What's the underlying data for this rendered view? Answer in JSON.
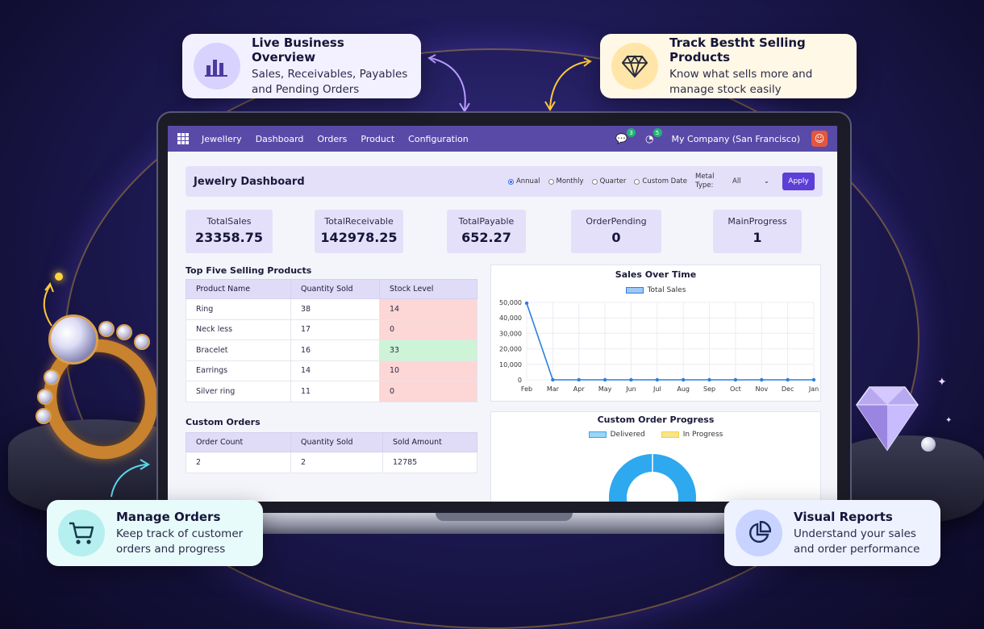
{
  "callouts": {
    "top_left": {
      "title": "Live Business Overview",
      "text": "Sales, Receivables, Payables and Pending Orders",
      "icon": "bar-chart-icon"
    },
    "top_right": {
      "title": "Track Bestht Selling Products",
      "text": "Know what sells more and manage stock easily",
      "icon": "diamond-icon"
    },
    "bottom_left": {
      "title": "Manage Orders",
      "text": "Keep track of customer orders and progress",
      "icon": "cart-icon"
    },
    "bottom_right": {
      "title": "Visual Reports",
      "text": "Understand your sales and order performance",
      "icon": "pie-chart-icon"
    }
  },
  "navbar": {
    "items": [
      "Jewellery",
      "Dashboard",
      "Orders",
      "Product",
      "Configuration"
    ],
    "chat_badge": "3",
    "activity_badge": "5",
    "company": "My Company (San Francisco)"
  },
  "dashboard": {
    "title": "Jewelry Dashboard",
    "periods": [
      "Annual",
      "Monthly",
      "Quarter",
      "Custom Date"
    ],
    "selected_period": "Annual",
    "metal_label": "Metal Type:",
    "metal_value": "All",
    "apply_label": "Apply"
  },
  "stats": [
    {
      "label": "TotalSales",
      "value": "23358.75"
    },
    {
      "label": "TotalReceivable",
      "value": "142978.25"
    },
    {
      "label": "TotalPayable",
      "value": "652.27"
    },
    {
      "label": "OrderPending",
      "value": "0"
    },
    {
      "label": "MainProgress",
      "value": "1"
    }
  ],
  "top_products": {
    "title": "Top Five Selling Products",
    "columns": [
      "Product Name",
      "Quantity Sold",
      "Stock Level"
    ],
    "rows": [
      {
        "name": "Ring",
        "qty": "38",
        "stock": "14",
        "status": "low"
      },
      {
        "name": "Neck less",
        "qty": "17",
        "stock": "0",
        "status": "low"
      },
      {
        "name": "Bracelet",
        "qty": "16",
        "stock": "33",
        "status": "ok"
      },
      {
        "name": "Earrings",
        "qty": "14",
        "stock": "10",
        "status": "low"
      },
      {
        "name": "Silver ring",
        "qty": "11",
        "stock": "0",
        "status": "low"
      }
    ]
  },
  "custom_orders": {
    "title": "Custom Orders",
    "columns": [
      "Order Count",
      "Quantity Sold",
      "Sold Amount"
    ],
    "rows": [
      {
        "count": "2",
        "qty": "2",
        "amount": "12785"
      }
    ]
  },
  "colors": {
    "navbar": "#5a4aa8",
    "accent": "#5b3fd6",
    "line": "#2b7fe0",
    "delivered": "#2ea8ee",
    "in_progress": "#f5d23a"
  },
  "chart_data": [
    {
      "type": "line",
      "title": "Sales Over Time",
      "x": [
        "Feb",
        "Mar",
        "Apr",
        "May",
        "Jun",
        "Jul",
        "Aug",
        "Sep",
        "Oct",
        "Nov",
        "Dec",
        "Jan"
      ],
      "series": [
        {
          "name": "Total Sales",
          "values": [
            49500,
            0,
            0,
            0,
            0,
            0,
            0,
            0,
            0,
            0,
            0,
            0
          ]
        }
      ],
      "yticks": [
        "50,000",
        "40,000",
        "30,000",
        "20,000",
        "10,000",
        "0"
      ],
      "ylim": [
        0,
        50000
      ],
      "grid": true,
      "legend": "top"
    },
    {
      "type": "pie",
      "title": "Custom Order Progress",
      "categories": [
        "Delivered",
        "In Progress"
      ],
      "values": [
        2,
        0
      ],
      "legend": "top"
    }
  ]
}
